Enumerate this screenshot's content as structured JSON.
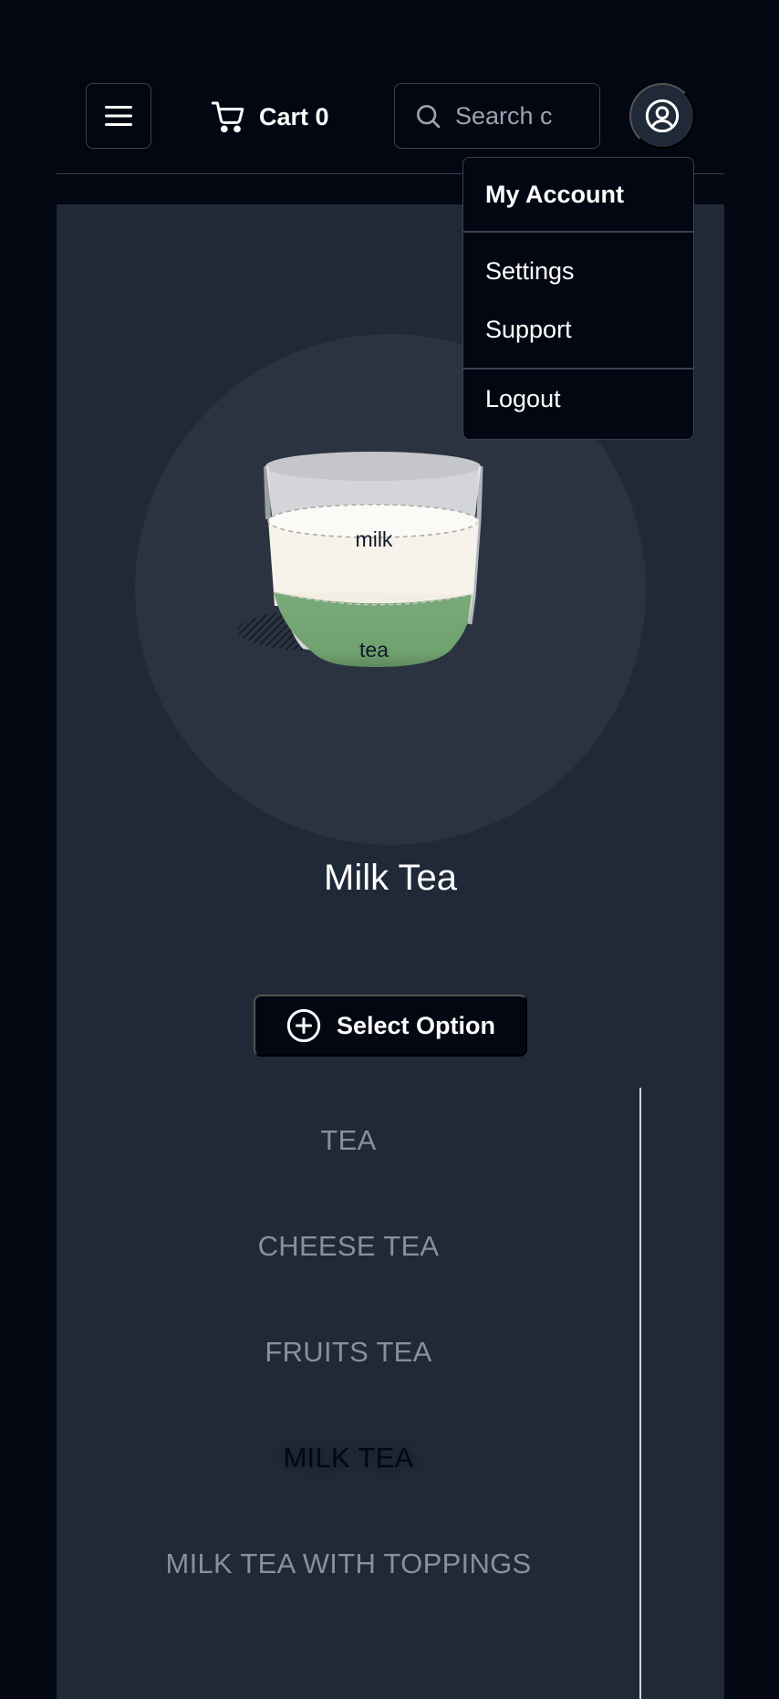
{
  "header": {
    "cart_label": "Cart 0",
    "search_placeholder": "Search c",
    "icons": {
      "menu": "hamburger-menu-icon",
      "cart": "shopping-cart-icon",
      "search": "search-icon",
      "account": "user-circle-icon"
    }
  },
  "account_menu": {
    "heading": "My Account",
    "items": [
      "Settings",
      "Support"
    ],
    "logout": "Logout"
  },
  "product": {
    "name": "Milk Tea",
    "layers": {
      "top": "milk",
      "bottom": "tea"
    },
    "colors": {
      "milk": "#f7f3ea",
      "tea": "#74a574"
    }
  },
  "select_option": {
    "label": "Select Option",
    "icon": "plus-circle-icon"
  },
  "categories": {
    "items": [
      "TEA",
      "CHEESE TEA",
      "FRUITS TEA",
      "MILK TEA",
      "MILK TEA WITH TOPPINGS"
    ],
    "active": "MILK TEA"
  },
  "colors": {
    "background": "#030712",
    "panel": "#1f2937",
    "border": "#374151"
  }
}
